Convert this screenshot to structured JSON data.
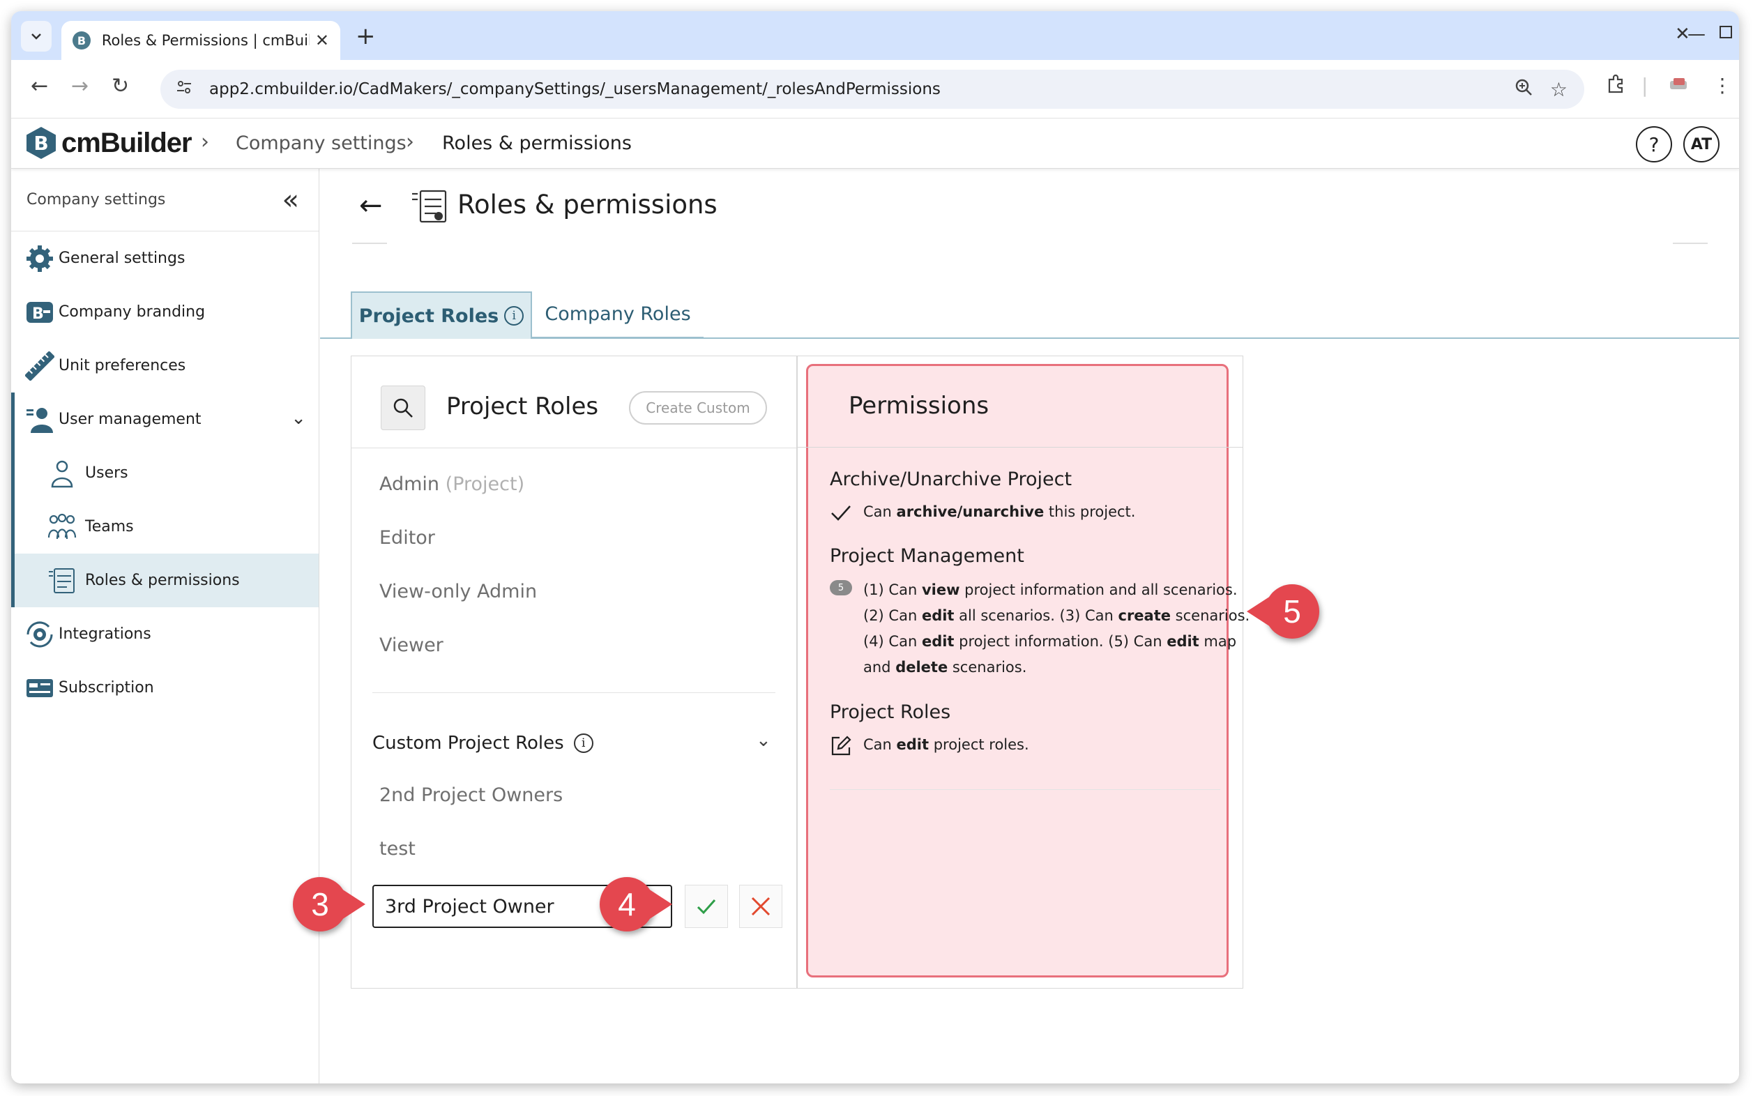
{
  "browser": {
    "tab_title": "Roles & Permissions | cmBuilder",
    "url": "app2.cmbuilder.io/CadMakers/_companySettings/_usersManagement/_rolesAndPermissions"
  },
  "header": {
    "logo_text": "cmBuilder",
    "breadcrumb": [
      "Company settings",
      "Roles & permissions"
    ],
    "help_label": "?",
    "avatar_initials": "AT"
  },
  "sidebar": {
    "title": "Company settings",
    "items": [
      {
        "label": "General settings",
        "icon": "gear-icon"
      },
      {
        "label": "Company branding",
        "icon": "branding-icon"
      },
      {
        "label": "Unit preferences",
        "icon": "ruler-icon"
      },
      {
        "label": "User management",
        "icon": "user-management-icon"
      },
      {
        "label": "Users",
        "icon": "user-icon"
      },
      {
        "label": "Teams",
        "icon": "teams-icon"
      },
      {
        "label": "Roles & permissions",
        "icon": "roles-icon"
      },
      {
        "label": "Integrations",
        "icon": "integrations-icon"
      },
      {
        "label": "Subscription",
        "icon": "subscription-icon"
      }
    ]
  },
  "page": {
    "title": "Roles & permissions",
    "tabs": [
      "Project Roles",
      "Company Roles"
    ],
    "tab_info": "i"
  },
  "roles_panel": {
    "title": "Project Roles",
    "create_button": "Create Custom",
    "roles": [
      {
        "name": "Admin",
        "suffix": "(Project)"
      },
      {
        "name": "Editor"
      },
      {
        "name": "View-only Admin"
      },
      {
        "name": "Viewer"
      }
    ],
    "custom_title": "Custom Project Roles",
    "custom_info": "i",
    "custom_roles": [
      "2nd Project Owners",
      "test"
    ],
    "new_role_value": "3rd Project Owner"
  },
  "permissions_panel": {
    "title": "Permissions",
    "sections": [
      {
        "title": "Archive/Unarchive Project",
        "lines": [
          [
            "Can ",
            "archive/unarchive",
            " this project."
          ]
        ]
      },
      {
        "title": "Project Management",
        "badge": "5",
        "lines": [
          [
            "(1) Can ",
            "view",
            " project information and all scenarios."
          ],
          [
            "(2) Can ",
            "edit",
            " all scenarios. (3) Can ",
            "create",
            " scenarios."
          ],
          [
            "(4) Can ",
            "edit",
            " project information. (5) Can ",
            "edit",
            " map"
          ],
          [
            "and ",
            "delete",
            " scenarios."
          ]
        ]
      },
      {
        "title": "Project Roles",
        "lines": [
          [
            "Can ",
            "edit",
            " project roles."
          ]
        ]
      }
    ]
  },
  "callouts": [
    "3",
    "4",
    "5"
  ],
  "colors": {
    "brand": "#33627a",
    "tab_active_bg": "#dcebf0",
    "highlight": "#e8707c",
    "callout": "#e4474f",
    "ok": "#2e9e48",
    "cancel": "#e2492e"
  }
}
